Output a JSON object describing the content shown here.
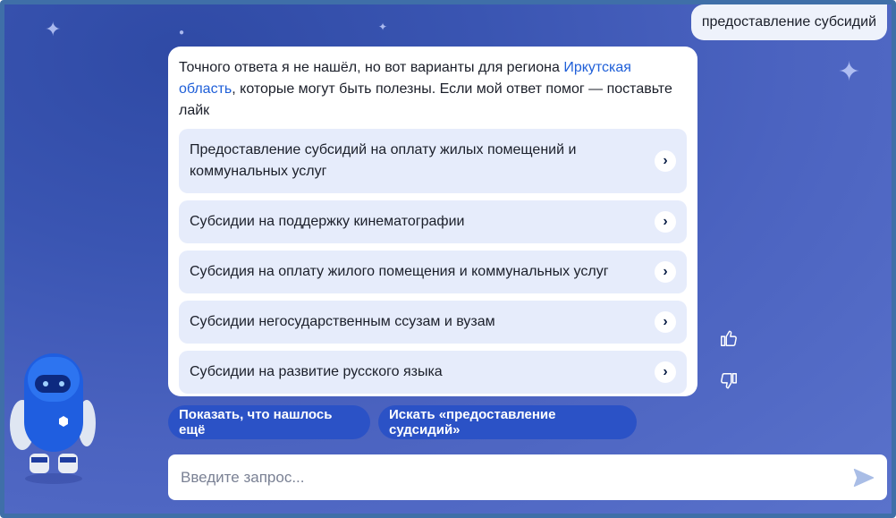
{
  "user_query": "предоставление субсидий",
  "answer": {
    "text_before": "Точного ответа я не нашёл, но вот варианты для региона ",
    "region_link": "Иркутская область",
    "text_after": ", которые могут быть полезны. Если мой ответ помог — поставьте лайк"
  },
  "options": [
    "Предоставление субсидий на оплату жилых помещений и коммунальных услуг",
    "Субсидии на поддержку кинематографии",
    "Субсидия на оплату жилого помещения и коммунальных услуг",
    "Субсидии негосударственным ссузам и вузам",
    "Субсидии на развитие русского языка"
  ],
  "actions": {
    "show_more": "Показать, что нашлось ещё",
    "search": "Искать «предоставление судсидий»"
  },
  "input": {
    "placeholder": "Введите запрос..."
  },
  "icons": {
    "option_arrow": "chevron-right-icon",
    "like": "thumbs-up-icon",
    "dislike": "thumbs-down-icon",
    "send": "send-icon"
  },
  "colors": {
    "accent": "#2b52c6",
    "link": "#1f5fd8",
    "option_bg": "#e6ecfb"
  }
}
